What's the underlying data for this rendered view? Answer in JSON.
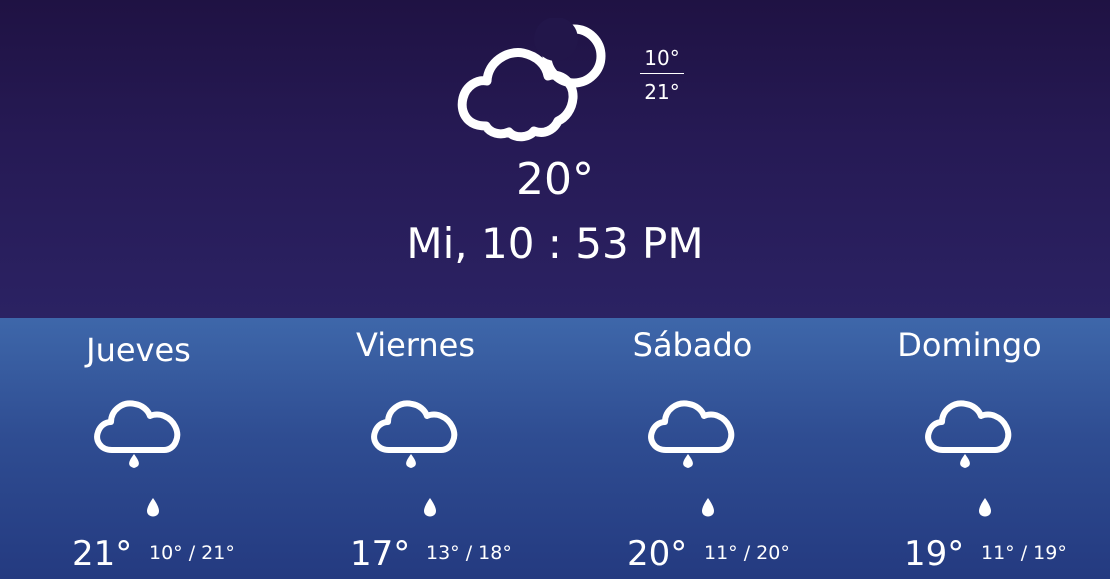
{
  "current": {
    "icon": "cloud-moon-icon",
    "min_temp": "10°",
    "max_temp": "21°",
    "temperature": "20°",
    "datetime": "Mi, 10 : 53 PM"
  },
  "forecast": [
    {
      "day": "Jueves",
      "icon": "cloud-rain-icon",
      "temp": "21°",
      "range": "10° / 21°"
    },
    {
      "day": "Viernes",
      "icon": "cloud-rain-icon",
      "temp": "17°",
      "range": "13° / 18°"
    },
    {
      "day": "Sábado",
      "icon": "cloud-rain-icon",
      "temp": "20°",
      "range": "11° / 20°"
    },
    {
      "day": "Domingo",
      "icon": "cloud-rain-icon",
      "temp": "19°",
      "range": "11° / 19°"
    }
  ],
  "colors": {
    "top_bg": "#22164a",
    "bottom_bg": "#3b63a6",
    "text": "#ffffff"
  }
}
